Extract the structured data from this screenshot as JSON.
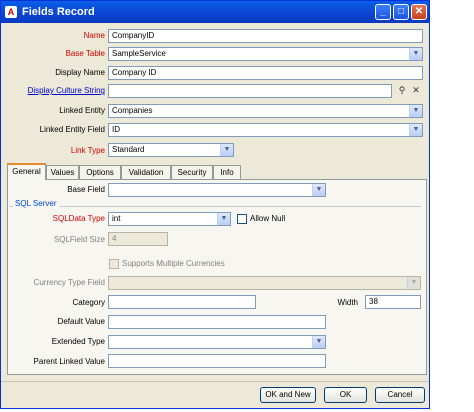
{
  "window": {
    "title": "Fields Record"
  },
  "form": {
    "name_label": "Name",
    "name_value": "CompanyID",
    "base_table_label": "Base Table",
    "base_table_value": "SampleService",
    "display_name_label": "Display Name",
    "display_name_value": "Company ID",
    "display_culture_label": "Display Culture String",
    "display_culture_value": "",
    "linked_entity_label": "Linked Entity",
    "linked_entity_value": "Companies",
    "linked_entity_field_label": "Linked Entity Field",
    "linked_entity_field_value": "ID",
    "link_type_label": "Link Type",
    "link_type_value": "Standard"
  },
  "tabs": [
    "General",
    "Values",
    "Options",
    "Validation",
    "Security",
    "Info"
  ],
  "general": {
    "base_field_label": "Base Field",
    "base_field_value": "",
    "sql_group_title": "SQL Server",
    "sql_data_type_label": "SQLData Type",
    "sql_data_type_value": "int",
    "allow_null_label": "Allow Null",
    "sql_field_size_label": "SQLField Size",
    "sql_field_size_value": "4",
    "supports_multi_currency_label": "Supports Multiple Currencies",
    "currency_type_field_label": "Currency Type Field",
    "currency_type_field_value": "",
    "category_label": "Category",
    "category_value": "",
    "width_label": "Width",
    "width_value": "38",
    "default_value_label": "Default Value",
    "default_value_value": "",
    "extended_type_label": "Extended Type",
    "extended_type_value": "",
    "parent_linked_value_label": "Parent Linked Value",
    "parent_linked_value_value": ""
  },
  "buttons": {
    "ok_new": "OK and New",
    "ok": "OK",
    "cancel": "Cancel"
  },
  "colors": {
    "required_label": "#d40000",
    "titlebar": "#0b45d3",
    "group_title": "#0046d5"
  }
}
